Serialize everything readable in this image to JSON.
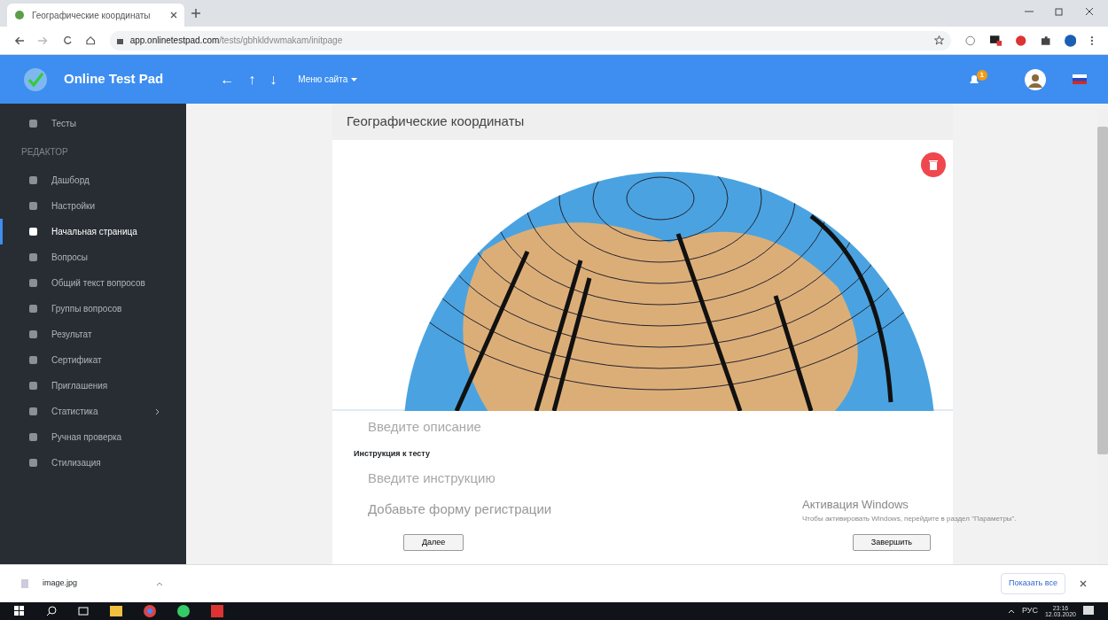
{
  "browser": {
    "tab_title": "Географические координаты",
    "url_host": "app.onlinetestpad.com",
    "url_path": "/tests/gbhkldvwmakam/initpage"
  },
  "header": {
    "brand": "Online Test Pad",
    "nav": [
      "←",
      "↑",
      "↓"
    ],
    "menu": "Меню сайта",
    "notifications": "1"
  },
  "sidebar": {
    "items": [
      {
        "kind": "item",
        "label": "Тесты",
        "selected": false
      },
      {
        "kind": "heading",
        "label": "РЕДАКТОР"
      },
      {
        "kind": "item",
        "label": "Дашборд",
        "selected": false
      },
      {
        "kind": "item",
        "label": "Настройки",
        "selected": false
      },
      {
        "kind": "item",
        "label": "Начальная страница",
        "selected": true
      },
      {
        "kind": "item",
        "label": "Вопросы",
        "selected": false
      },
      {
        "kind": "item",
        "label": "Общий текст вопросов",
        "selected": false
      },
      {
        "kind": "item",
        "label": "Группы вопросов",
        "selected": false
      },
      {
        "kind": "item",
        "label": "Результат",
        "selected": false
      },
      {
        "kind": "item",
        "label": "Сертификат",
        "selected": false
      },
      {
        "kind": "item",
        "label": "Приглашения",
        "selected": false
      },
      {
        "kind": "item",
        "label": "Статистика",
        "selected": false,
        "expandable": true
      },
      {
        "kind": "item",
        "label": "Ручная проверка",
        "selected": false
      },
      {
        "kind": "item",
        "label": "Стилизация",
        "selected": false
      }
    ]
  },
  "page": {
    "title": "Географические координаты",
    "description": {
      "placeholder": "Введите описание"
    },
    "instruction_label": "Инструкция к тесту",
    "instruction": {
      "placeholder": "Введите инструкцию"
    },
    "registration_link": "Добавьте форму регистрации",
    "buttons": [
      "Далее",
      "Завершить"
    ]
  },
  "windows_activation": {
    "title": "Активация Windows",
    "text": "Чтобы активировать Windows, перейдите в раздел \"Параметры\"."
  },
  "downloads": {
    "file": "image.jpg",
    "show_all": "Показать все"
  },
  "taskbar": {
    "language": "РУС",
    "time": "23:16",
    "date": "12.03.2020"
  }
}
